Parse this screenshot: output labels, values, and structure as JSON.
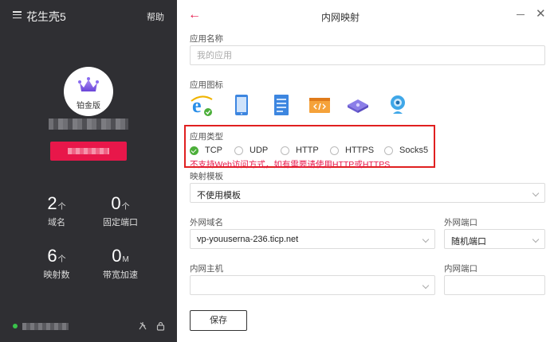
{
  "sidebar": {
    "app_title": "花生壳5",
    "help_label": "帮助",
    "tier_label": "铂金版",
    "stats": [
      {
        "num": "2",
        "unit": "个",
        "label": "域名"
      },
      {
        "num": "0",
        "unit": "个",
        "label": "固定端口"
      },
      {
        "num": "6",
        "unit": "个",
        "label": "映射数"
      },
      {
        "num": "0",
        "unit": "M",
        "label": "带宽加速"
      }
    ]
  },
  "dialog": {
    "title": "内网映射",
    "app_name": {
      "label": "应用名称",
      "placeholder": "我的应用",
      "value": ""
    },
    "app_icon": {
      "label": "应用图标",
      "icons": [
        "ie-icon",
        "tablet-icon",
        "document-icon",
        "code-window-icon",
        "router-icon",
        "camera-icon"
      ]
    },
    "app_type": {
      "label": "应用类型",
      "options": [
        "TCP",
        "UDP",
        "HTTP",
        "HTTPS",
        "Socks5"
      ],
      "selected": "TCP",
      "warning": "不支持Web访问方式，如有需要请使用HTTP或HTTPS"
    },
    "template": {
      "label": "映射模板",
      "value": "不使用模板"
    },
    "ext_domain": {
      "label": "外网域名",
      "value": "vp-youuserna-236.ticp.net"
    },
    "ext_port": {
      "label": "外网端口",
      "value": "随机端口"
    },
    "int_host": {
      "label": "内网主机",
      "value": ""
    },
    "int_port": {
      "label": "内网端口",
      "value": ""
    },
    "save_label": "保存"
  },
  "colors": {
    "accent": "#e8174a",
    "sidebar_bg": "#2f2f33",
    "check_green": "#4caf3a",
    "highlight_box": "#e02020"
  }
}
